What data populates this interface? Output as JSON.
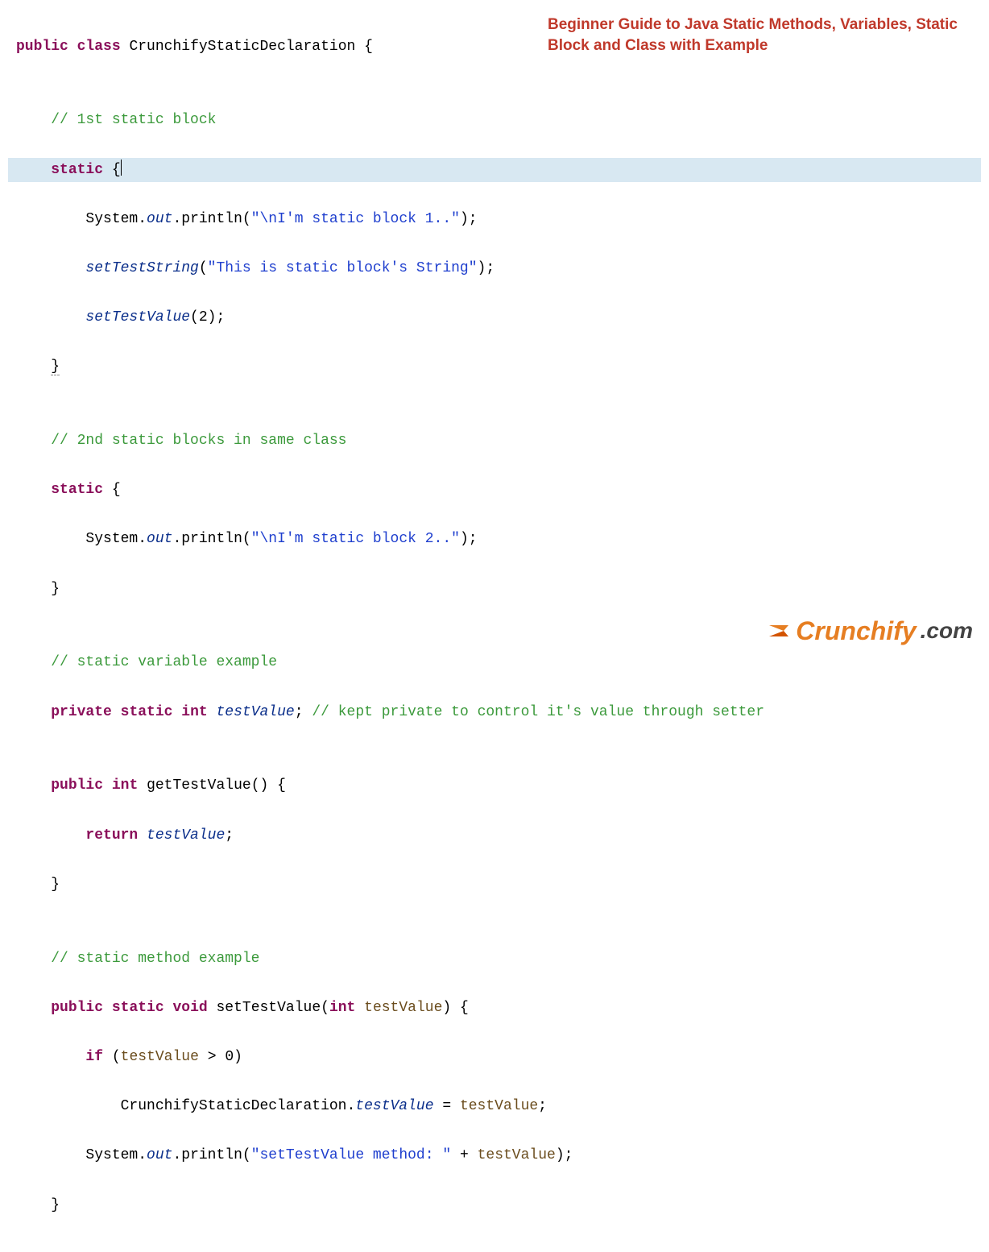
{
  "header": {
    "title": "Beginner Guide to Java Static Methods, Variables, Static Block and Class with Example"
  },
  "logo": {
    "brand": "Crunchify",
    "suffix": ".com"
  },
  "code": {
    "tokens": {
      "public": "public",
      "class": "class",
      "className": "CrunchifyStaticDeclaration",
      "lbrace": "{",
      "rbrace": "}",
      "static": "static",
      "private": "private",
      "int": "int",
      "void": "void",
      "return": "return",
      "if": "if",
      "System": "System",
      "out": "out",
      "println": "println",
      "setTestString": "setTestString",
      "setTestValue": "setTestValue",
      "getTestValue": "getTestValue",
      "testValue": "testValue",
      "dot": ".",
      "lparen": "(",
      "rparen": ")",
      "semi": ";",
      "gt": ">",
      "eq": "=",
      "plus": "+",
      "num2": "2",
      "num0": "0",
      "comment1": "// 1st static block",
      "comment2": "// 2nd static blocks in same class",
      "comment3": "// static variable example",
      "comment3b": "// kept private to control it's value through setter",
      "comment4": "// static method example",
      "str1": "\"\\nI'm static block 1..\"",
      "str2": "\"This is static block's String\"",
      "str3": "\"\\nI'm static block 2..\"",
      "str4": "\"setTestValue method: \""
    }
  }
}
